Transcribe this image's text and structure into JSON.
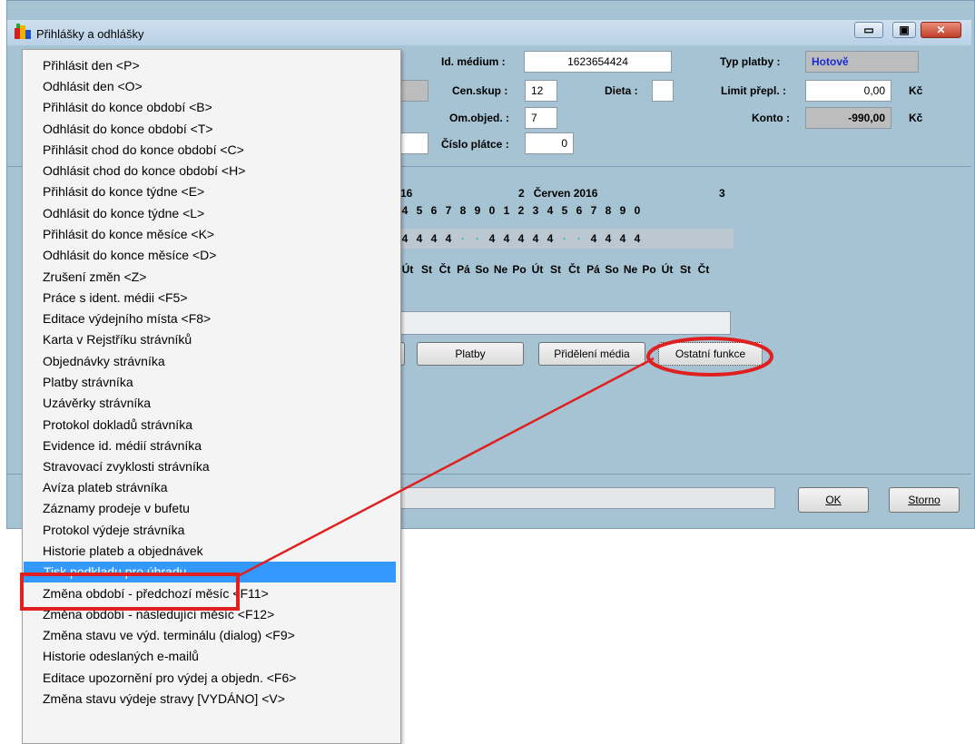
{
  "window": {
    "title": "Přihlášky a odhlášky",
    "caption_buttons": {
      "minimize": "▭",
      "maximize": "▣",
      "close": "✕"
    }
  },
  "fields": {
    "id_medium_label": "Id. médium :",
    "id_medium_value": "1623654424",
    "typ_platby_label": "Typ platby :",
    "typ_platby_value": "Hotově",
    "cen_skup_label": "Cen.skup :",
    "cen_skup_value": "12",
    "dieta_label": "Dieta :",
    "dieta_value": "",
    "limit_label": "Limit přepl. :",
    "limit_value": "0,00",
    "limit_unit": "Kč",
    "om_objed_label": "Om.objed. :",
    "om_objed_value": "7",
    "konto_label": "Konto :",
    "konto_value": "-990,00",
    "konto_unit": "Kč",
    "cislo_platce_label": "Číslo plátce :",
    "cislo_platce_value": "0"
  },
  "calendar": {
    "row1": [
      "16",
      "",
      "",
      "",
      "",
      "",
      "",
      "",
      "2",
      "Červen 2016",
      "",
      "",
      "",
      "",
      "",
      "",
      "",
      "",
      "",
      "3"
    ],
    "row2": [
      "4",
      "5",
      "6",
      "7",
      "8",
      "9",
      "0",
      "1",
      "2",
      "3",
      "4",
      "5",
      "6",
      "7",
      "8",
      "9",
      "0"
    ],
    "values": [
      "4",
      "4",
      "4",
      "4",
      "·",
      "·",
      "4",
      "4",
      "4",
      "4",
      "4",
      "·",
      "·",
      "4",
      "4",
      "4",
      "4"
    ],
    "weekdays": [
      "Út",
      "St",
      "Čt",
      "Pá",
      "So",
      "Ne",
      "Po",
      "Út",
      "St",
      "Čt",
      "Pá",
      "So",
      "Ne",
      "Po",
      "Út",
      "St",
      "Čt"
    ]
  },
  "buttons": {
    "platby": "Platby",
    "prideleni": "Přidělení média",
    "ostatni": "Ostatní funkce",
    "ok": "OK",
    "storno": "Storno"
  },
  "menu": {
    "items": [
      "Přihlásit den    <P>",
      "Odhlásit den    <O>",
      "Přihlásit do konce období    <B>",
      "Odhlásit do konce období    <T>",
      "Přihlásit chod do konce období    <C>",
      "Odhlásit chod do konce období    <H>",
      "Přihlásit do konce týdne    <E>",
      "Odhlásit do konce týdne    <L>",
      "Přihlásit do konce měsíce    <K>",
      "Odhlásit do konce měsíce    <D>",
      "Zrušení změn    <Z>",
      "Práce s ident. médii    <F5>",
      "Editace výdejního místa    <F8>",
      "Karta v Rejstříku strávníků",
      "Objednávky strávníka",
      "Platby strávníka",
      "Uzávěrky strávníka",
      "Protokol dokladů strávníka",
      "Evidence id. médií strávníka",
      "Stravovací zvyklosti strávníka",
      "Avíza plateb strávníka",
      "Záznamy prodeje v bufetu",
      "Protokol výdeje strávníka",
      "Historie plateb a objednávek",
      "Tisk podkladu pro úhradu",
      "Změna období - předchozí měsíc    <F11>",
      "Změna období - následující měsíc    <F12>",
      "Změna stavu ve výd. terminálu (dialog)    <F9>",
      "Historie odeslaných e-mailů",
      "Editace upozornění pro výdej a objedn.    <F6>",
      "Změna stavu výdeje stravy [VYDÁNO]    <V>"
    ],
    "selected_index": 24
  },
  "colors": {
    "window_bg": "#a6c3d3",
    "menu_highlight": "#3399ff",
    "annotation": "#e02020"
  }
}
